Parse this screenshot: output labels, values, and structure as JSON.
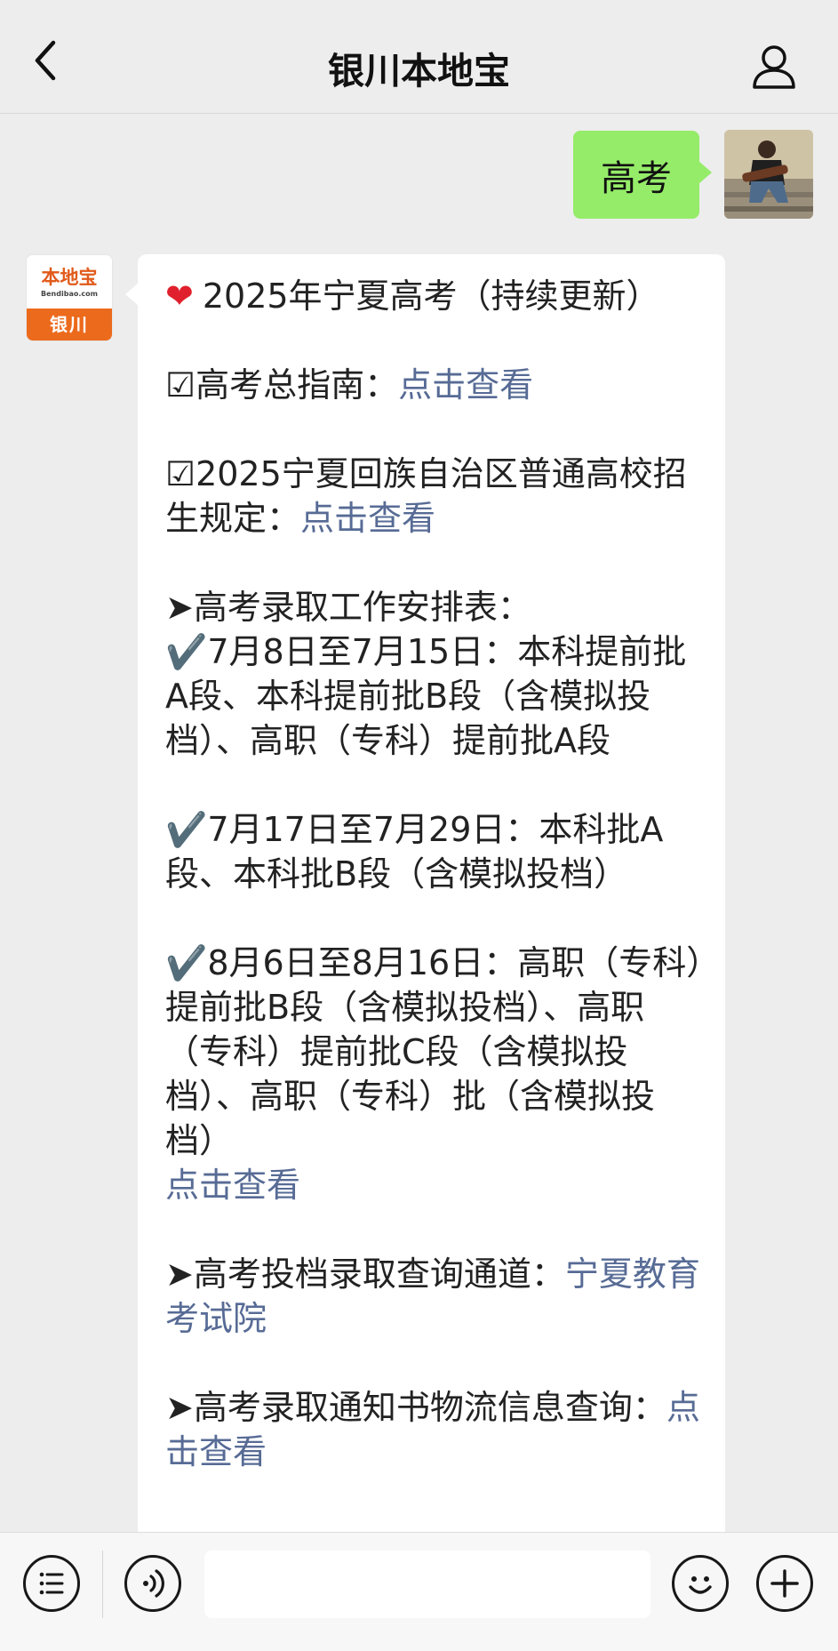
{
  "header": {
    "title": "银川本地宝"
  },
  "outgoing": {
    "text": "高考"
  },
  "bot": {
    "logo_text": "本地宝",
    "logo_sub": "Bendibao.com",
    "logo_city": "银川"
  },
  "message": {
    "headline": "2025年宁夏高考（持续更新）",
    "guide_label": "☑高考总指南：",
    "guide_link": "点击查看",
    "rules_label": "☑2025宁夏回族自治区普通高校招生规定：",
    "rules_link": "点击查看",
    "schedule_title": "➤高考录取工作安排表：",
    "schedule": [
      "✔️7月8日至7月15日：本科提前批A段、本科提前批B段（含模拟投档）、高职（专科）提前批A段",
      "✔️7月17日至7月29日：本科批A段、本科批B段（含模拟投档）",
      "✔️8月6日至8月16日：高职（专科）提前批B段（含模拟投档）、高职（专科）提前批C段（含模拟投档）、高职（专科）批（含模拟投档）"
    ],
    "schedule_link": "点击查看",
    "query_label": "➤高考投档录取查询通道：",
    "query_link": "宁夏教育考试院",
    "logistics_label": "➤高考录取通知书物流信息查询：",
    "logistics_link": "点击查看"
  },
  "colors": {
    "link": "#576b95",
    "outgoing_bubble": "#95ec69",
    "heart": "#e0202c",
    "brand_orange": "#ec6a1c"
  },
  "icons": {
    "back": "chevron-left-icon",
    "profile": "person-icon",
    "menu": "list-icon",
    "voice": "voice-icon",
    "emoji": "smiley-icon",
    "plus": "plus-icon"
  }
}
